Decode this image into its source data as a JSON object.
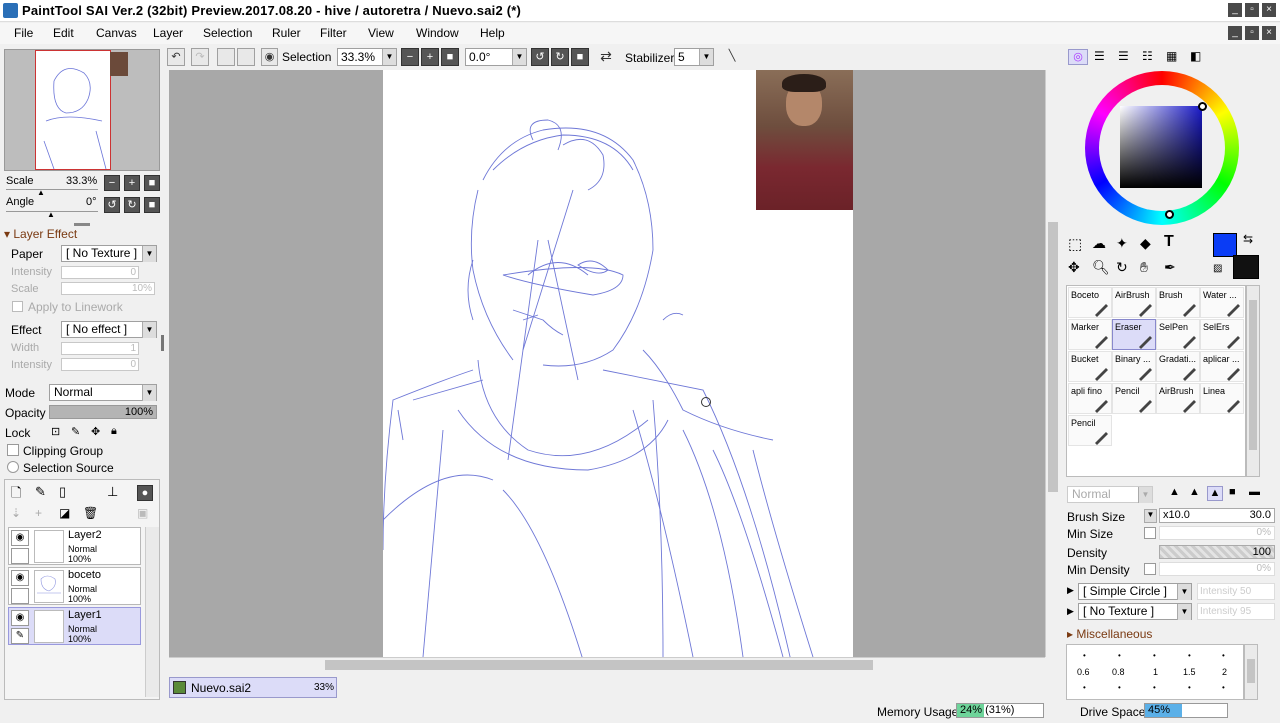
{
  "window": {
    "title": "PaintTool SAI Ver.2 (32bit) Preview.2017.08.20 - hive / autoretra / Nuevo.sai2 (*)"
  },
  "menu": [
    "File",
    "Edit",
    "Canvas",
    "Layer",
    "Selection",
    "Ruler",
    "Filter",
    "View",
    "Window",
    "Help"
  ],
  "toolbar": {
    "selection_label": "Selection",
    "zoom_value": "33.3%",
    "angle_value": "0.0°",
    "stabilizer_label": "Stabilizer",
    "stabilizer_value": "5"
  },
  "navigator": {
    "scale_label": "Scale",
    "scale_value": "33.3%",
    "angle_label": "Angle",
    "angle_value": "0°"
  },
  "layer_effect": {
    "header": "Layer Effect",
    "paper_label": "Paper",
    "paper_value": "[ No Texture ]",
    "intensity_label": "Intensity",
    "intensity_value": "0",
    "scale_label": "Scale",
    "scale_value": "10%",
    "apply_label": "Apply to Linework",
    "effect_label": "Effect",
    "effect_value": "[ No effect ]",
    "width_label": "Width",
    "width_value": "1",
    "intensity2_label": "Intensity",
    "intensity2_value": "0"
  },
  "layer_props": {
    "mode_label": "Mode",
    "mode_value": "Normal",
    "opacity_label": "Opacity",
    "opacity_value": "100%",
    "lock_label": "Lock",
    "clipping_label": "Clipping Group",
    "selection_source_label": "Selection Source"
  },
  "layers": [
    {
      "name": "Layer2",
      "mode": "Normal",
      "opacity": "100%"
    },
    {
      "name": "boceto",
      "mode": "Normal",
      "opacity": "100%"
    },
    {
      "name": "Layer1",
      "mode": "Normal",
      "opacity": "100%"
    }
  ],
  "tools": [
    {
      "label": "Boceto"
    },
    {
      "label": "AirBrush"
    },
    {
      "label": "Brush"
    },
    {
      "label": "Water ..."
    },
    {
      "label": "Marker"
    },
    {
      "label": "Eraser"
    },
    {
      "label": "SelPen"
    },
    {
      "label": "SelErs"
    },
    {
      "label": "Bucket"
    },
    {
      "label": "Binary ..."
    },
    {
      "label": "Gradati..."
    },
    {
      "label": "aplicar ..."
    },
    {
      "label": "apli fino"
    },
    {
      "label": "Pencil"
    },
    {
      "label": "AirBrush"
    },
    {
      "label": "Linea"
    },
    {
      "label": "Pencil"
    }
  ],
  "brush": {
    "blend_value": "Normal",
    "size_label": "Brush Size",
    "size_mult": "x10.0",
    "size_value": "30.0",
    "min_size_label": "Min Size",
    "min_size_value": "0%",
    "density_label": "Density",
    "density_value": "100",
    "min_density_label": "Min Density",
    "min_density_value": "0%",
    "shape_value": "[ Simple Circle ]",
    "shape_intensity": "Intensity 50",
    "texture_value": "[ No Texture ]",
    "texture_intensity": "Intensity 95",
    "misc_label": "Miscellaneous",
    "dot_sizes": [
      "0.6",
      "0.8",
      "1",
      "1.5",
      "2"
    ]
  },
  "tab": {
    "name": "Nuevo.sai2",
    "zoom": "33%"
  },
  "status": {
    "memory_label": "Memory Usage",
    "memory_value": "24% (31%)",
    "memory_fill": 0.31,
    "drive_label": "Drive Space",
    "drive_value": "45%",
    "drive_fill": 0.45
  },
  "colors": {
    "primary": "#0a3cf5",
    "secondary": "#111111",
    "picker_hue": "#1a1ac8"
  }
}
